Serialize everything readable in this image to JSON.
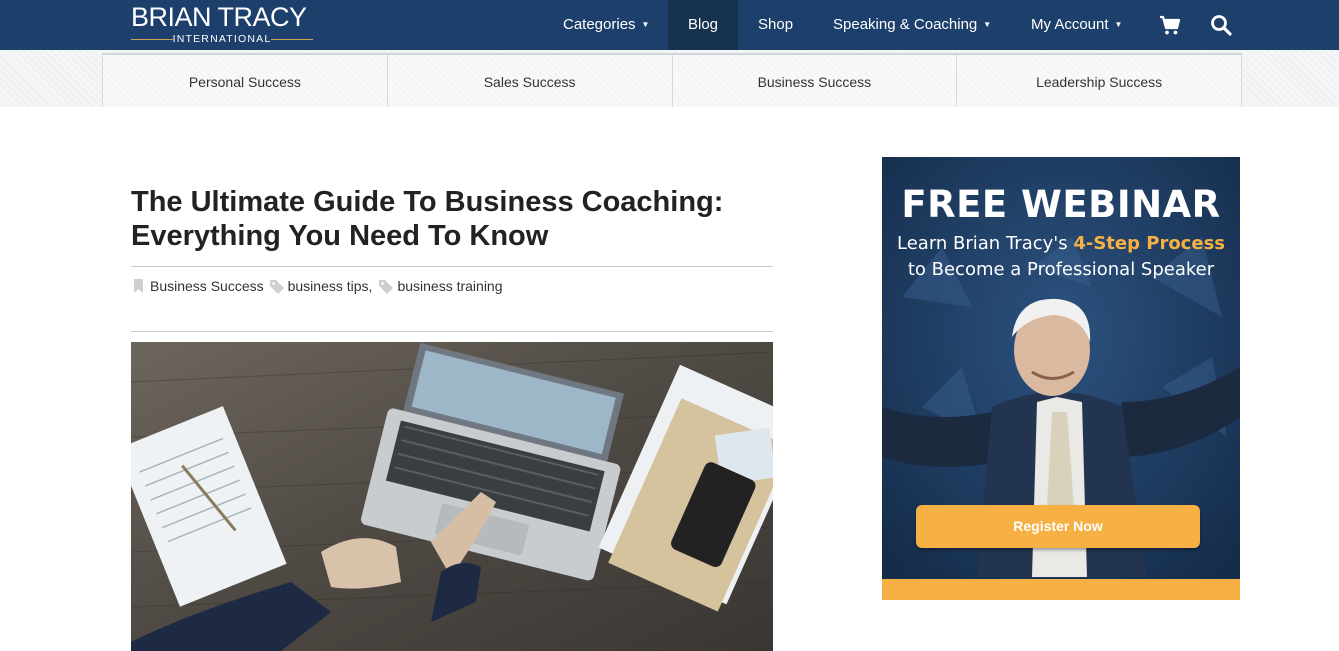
{
  "logo": {
    "main": "BRIAN TRACY",
    "sub": "INTERNATIONAL"
  },
  "nav": {
    "categories": "Categories",
    "blog": "Blog",
    "shop": "Shop",
    "speaking": "Speaking & Coaching",
    "account": "My Account"
  },
  "subnav": [
    "Personal Success",
    "Sales Success",
    "Business Success",
    "Leadership Success"
  ],
  "article": {
    "title_line1": "The Ultimate Guide To Business Coaching:",
    "title_line2": "Everything You Need To Know",
    "category": "Business Success",
    "tag1": "business tips,",
    "tag2": "business training"
  },
  "ad": {
    "title": "FREE WEBINAR",
    "line1_pre": "Learn Brian Tracy's ",
    "line1_highlight": "4-Step Process",
    "line2": "to Become a Professional Speaker",
    "button": "Register Now"
  },
  "colors": {
    "nav_bg": "#1d3f6b",
    "accent": "#f6b043"
  }
}
